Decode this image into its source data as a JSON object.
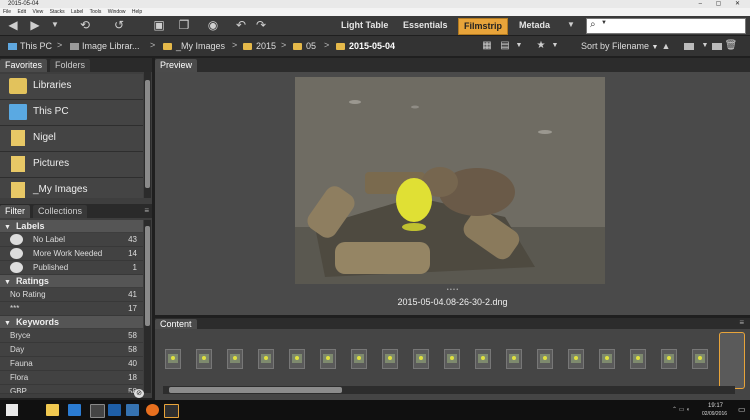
{
  "window": {
    "title": "2015-05-04",
    "controls": "– ▢ ✕"
  },
  "menu": [
    "File",
    "Edit",
    "View",
    "Stacks",
    "Label",
    "Tools",
    "Window",
    "Help"
  ],
  "workspaces": [
    "Light Table",
    "Essentials",
    "Filmstrip",
    "Metada"
  ],
  "active_workspace": "Filmstrip",
  "search": {
    "placeholder": "",
    "icon": "search-icon"
  },
  "path": [
    "This PC",
    "Image Librar...",
    "_My Images",
    "2015",
    "05",
    "2015-05-04"
  ],
  "path_sep": ">",
  "sort": {
    "label": "Sort by Filename"
  },
  "left": {
    "tabs": [
      "Favorites",
      "Folders"
    ],
    "favorites": [
      "Libraries",
      "This PC",
      "Nigel",
      "Pictures",
      "_My Images"
    ],
    "filter_tabs": [
      "Filter",
      "Collections"
    ],
    "labels_header": "Labels",
    "labels": [
      {
        "name": "No Label",
        "count": "43"
      },
      {
        "name": "More Work Needed",
        "count": "14"
      },
      {
        "name": "Published",
        "count": "1"
      }
    ],
    "ratings_header": "Ratings",
    "ratings": [
      {
        "name": "No Rating",
        "count": "41"
      },
      {
        "name": "***",
        "count": "17"
      }
    ],
    "keywords_header": "Keywords",
    "keywords": [
      {
        "name": "Bryce",
        "count": "58"
      },
      {
        "name": "Day",
        "count": "58"
      },
      {
        "name": "Fauna",
        "count": "40"
      },
      {
        "name": "Flora",
        "count": "18"
      },
      {
        "name": "GBP",
        "count": "58"
      }
    ]
  },
  "preview": {
    "tab": "Preview",
    "filename": "2015-05-04.08-26-30-2.dng",
    "dots": "• • • •"
  },
  "content": {
    "tab": "Content",
    "thumb_count": 19
  },
  "taskbar": {
    "time": "19:17",
    "date": "02/09/2016"
  }
}
